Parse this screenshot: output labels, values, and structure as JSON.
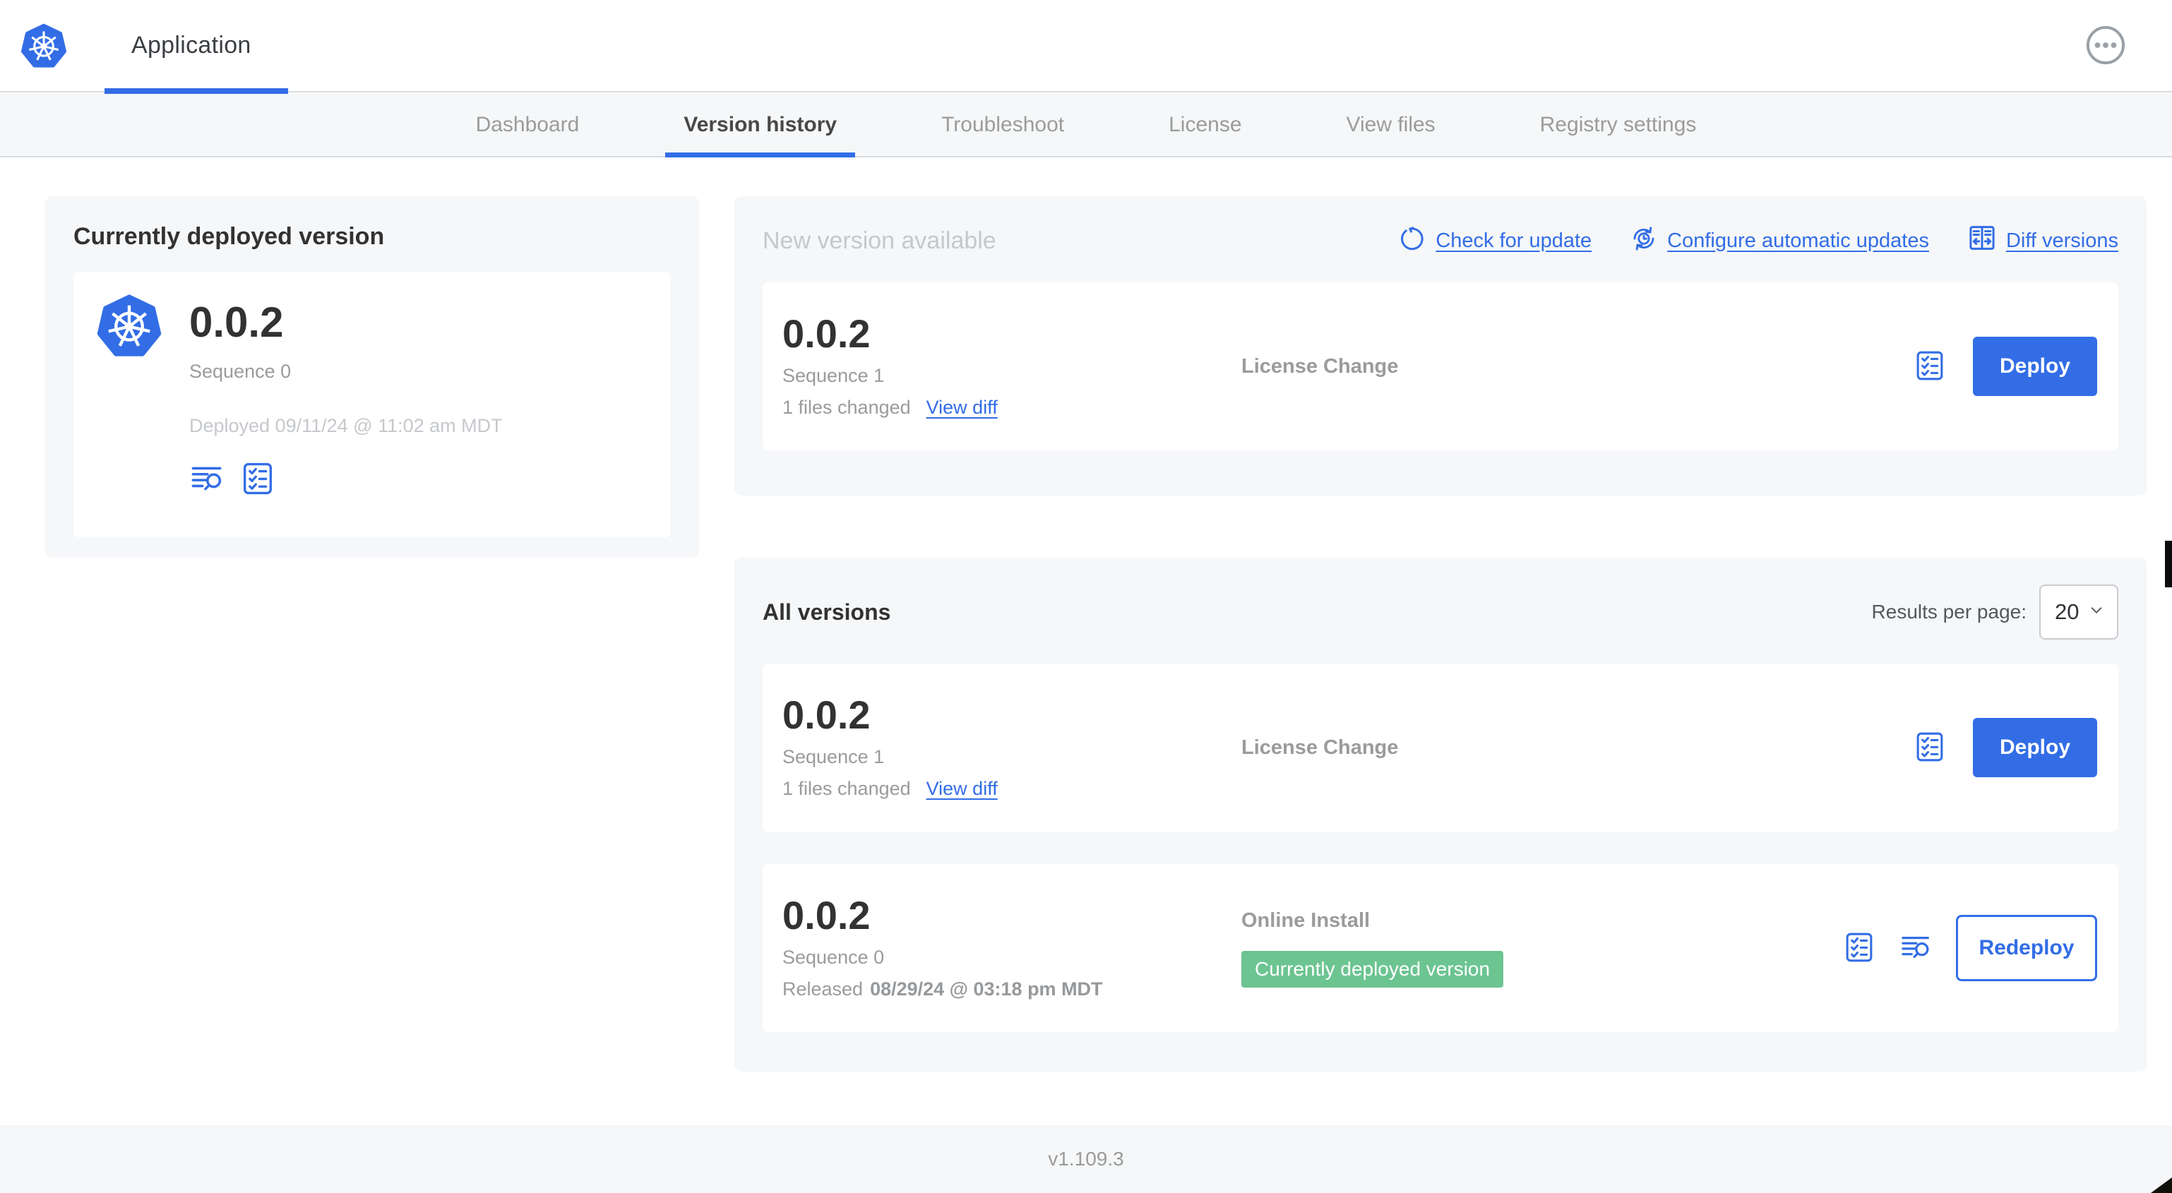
{
  "header": {
    "app_title": "Application",
    "menu_icon": "ellipsis-circle-icon"
  },
  "nav": {
    "tabs": [
      {
        "label": "Dashboard"
      },
      {
        "label": "Version history"
      },
      {
        "label": "Troubleshoot"
      },
      {
        "label": "License"
      },
      {
        "label": "View files"
      },
      {
        "label": "Registry settings"
      }
    ],
    "active_tab": "Version history"
  },
  "deployed_panel": {
    "title": "Currently deployed version",
    "version": "0.0.2",
    "sequence": "Sequence 0",
    "deployed_at": "Deployed 09/11/24 @ 11:02 am MDT",
    "icons": [
      "log-search-icon",
      "preflight-checklist-icon"
    ]
  },
  "new_version_panel": {
    "title": "New version available",
    "actions": {
      "check_for_update": "Check for update",
      "configure_automatic_updates": "Configure automatic updates",
      "diff_versions": "Diff versions"
    },
    "version_row": {
      "version": "0.0.2",
      "sequence": "Sequence 1",
      "files_changed": "1 files changed",
      "view_diff": "View diff",
      "source": "License Change",
      "deploy_button": "Deploy"
    }
  },
  "all_versions_panel": {
    "title": "All versions",
    "results_per_page_label": "Results per page:",
    "results_per_page_value": "20",
    "rows": [
      {
        "version": "0.0.2",
        "sequence": "Sequence 1",
        "files_changed": "1 files changed",
        "view_diff": "View diff",
        "source": "License Change",
        "action_button": "Deploy"
      },
      {
        "version": "0.0.2",
        "sequence": "Sequence 0",
        "released_label": "Released",
        "released_date": "08/29/24 @ 03:18 pm MDT",
        "source": "Online Install",
        "status_badge": "Currently deployed version",
        "action_button": "Redeploy"
      }
    ]
  },
  "footer": {
    "version": "v1.109.3"
  },
  "colors": {
    "accent": "#326de6",
    "badge_green": "#6cc491",
    "panel_bg": "#f5f7f9",
    "muted_text": "#9b9b9b",
    "light_text": "#c5c8cc",
    "dark_text": "#323232"
  }
}
